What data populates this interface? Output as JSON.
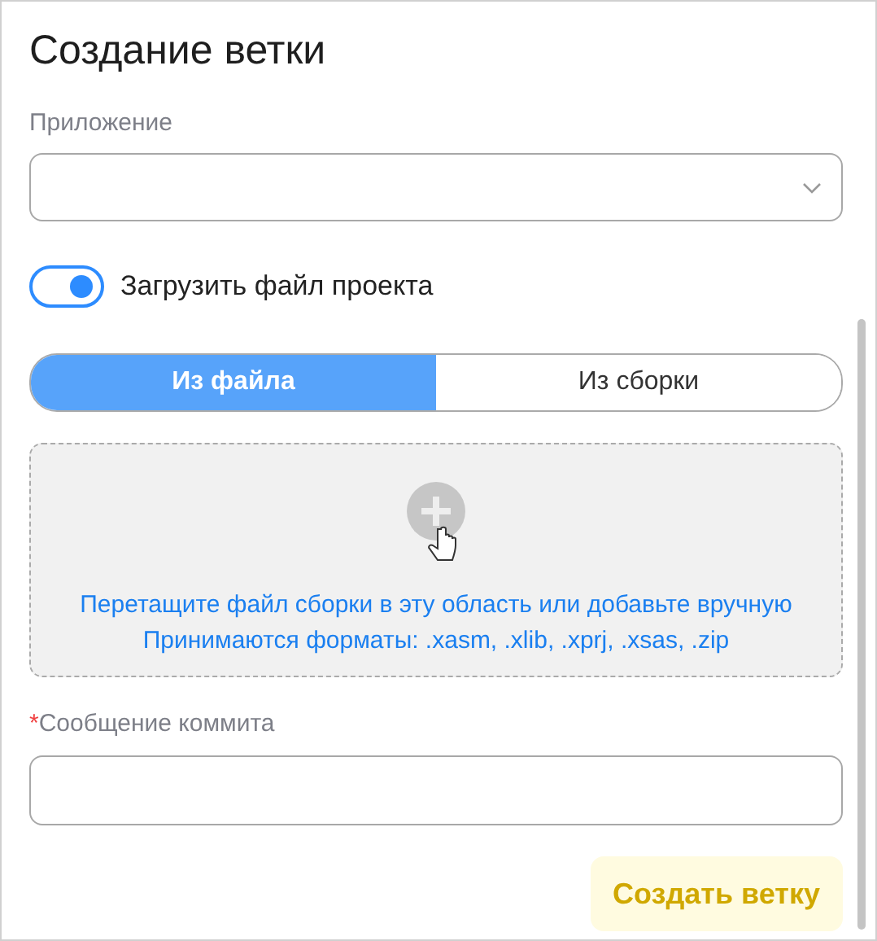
{
  "dialog": {
    "title": "Создание ветки"
  },
  "application": {
    "label": "Приложение"
  },
  "upload_toggle": {
    "label": "Загрузить файл проекта",
    "on": true
  },
  "source_tabs": [
    {
      "label": "Из файла",
      "selected": true
    },
    {
      "label": "Из сборки",
      "selected": false
    }
  ],
  "dropzone": {
    "lines": [
      "Перетащите файл сборки в эту область или добавьте вручную",
      "Принимаются форматы: .xasm, .xlib, .xprj, .xsas, .zip"
    ]
  },
  "commit_message": {
    "label": "Сообщение коммита",
    "required_mark": "*"
  },
  "buttons": [
    "Создать ветку"
  ]
}
